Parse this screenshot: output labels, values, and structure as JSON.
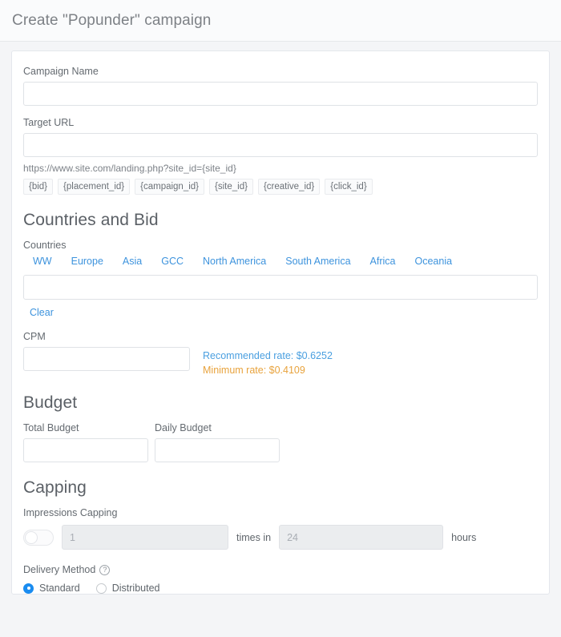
{
  "header": {
    "title": "Create \"Popunder\" campaign"
  },
  "form": {
    "campaign_name": {
      "label": "Campaign Name",
      "value": "",
      "placeholder": ""
    },
    "target_url": {
      "label": "Target URL",
      "value": "",
      "placeholder": "",
      "hint": "https://www.site.com/landing.php?site_id={site_id}",
      "macros": [
        "{bid}",
        "{placement_id}",
        "{campaign_id}",
        "{site_id}",
        "{creative_id}",
        "{click_id}"
      ]
    }
  },
  "countries_and_bid": {
    "heading": "Countries and Bid",
    "countries_label": "Countries",
    "regions": [
      "WW",
      "Europe",
      "Asia",
      "GCC",
      "North America",
      "South America",
      "Africa",
      "Oceania"
    ],
    "countries_value": "",
    "clear_label": "Clear",
    "cpm": {
      "label": "CPM",
      "value": "",
      "recommended_rate": "Recommended rate: $0.6252",
      "minimum_rate": "Minimum rate: $0.4109"
    }
  },
  "budget": {
    "heading": "Budget",
    "total": {
      "label": "Total Budget",
      "value": ""
    },
    "daily": {
      "label": "Daily Budget",
      "value": ""
    }
  },
  "capping": {
    "heading": "Capping",
    "impressions_label": "Impressions Capping",
    "toggle_state": "off",
    "times_placeholder": "1",
    "times_value": "",
    "middle_text": "times in",
    "hours_placeholder": "24",
    "hours_value": "",
    "trailing_text": "hours"
  },
  "delivery": {
    "label": "Delivery Method",
    "help_icon": "question-mark-icon",
    "options": [
      {
        "label": "Standard",
        "selected": true
      },
      {
        "label": "Distributed",
        "selected": false
      }
    ]
  },
  "colors": {
    "link": "#3d93dd",
    "accent": "#1a8cf0",
    "recommended": "#4a9fe0",
    "minimum": "#e8a33d",
    "page_bg": "#f4f5f7"
  }
}
